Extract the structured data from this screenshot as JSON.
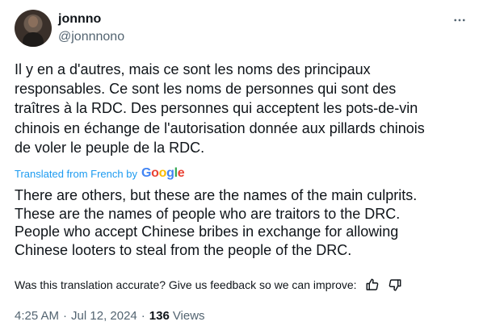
{
  "author": {
    "name": "jonnno",
    "handle": "@jonnnono"
  },
  "post": {
    "original_lines": [
      "Il y en a d'autres, mais ce sont les noms des principaux",
      "responsables. Ce sont les noms de personnes qui sont des",
      "traîtres à la RDC. Des personnes qui acceptent les pots-de-vin",
      "chinois en échange de l'autorisation donnée aux pillards chinois",
      "de voler le peuple de la RDC."
    ],
    "translated_from": "Translated from French by",
    "translator_brand": "Google",
    "translation_lines": [
      "There are others, but these are the names of the main culprits.",
      "These are the names of people who are traitors to the DRC.",
      "People who accept Chinese bribes in exchange for allowing",
      "Chinese looters to steal from the people of the DRC."
    ],
    "feedback_prompt": "Was this translation accurate? Give us feedback so we can improve:"
  },
  "meta": {
    "time": "4:25 AM",
    "separator": "·",
    "date": "Jul 12, 2024",
    "views_count": "136",
    "views_label": "Views"
  },
  "icons": {
    "more": "more-horizontal-icon",
    "thumbs_up": "thumbs-up-icon",
    "thumbs_down": "thumbs-down-icon"
  },
  "colors": {
    "text": "#0f1419",
    "secondary": "#536471",
    "link": "#1d9bf0"
  }
}
